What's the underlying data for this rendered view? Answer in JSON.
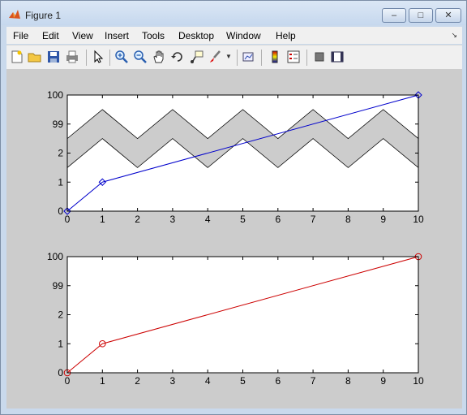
{
  "window": {
    "title": "Figure 1",
    "menu": [
      "File",
      "Edit",
      "View",
      "Insert",
      "Tools",
      "Desktop",
      "Window",
      "Help"
    ],
    "toolbar_icons": [
      "new-figure-icon",
      "open-file-icon",
      "save-icon",
      "print-icon",
      "pointer-icon",
      "zoom-in-icon",
      "zoom-out-icon",
      "pan-icon",
      "rotate-3d-icon",
      "data-cursor-icon",
      "brush-icon",
      "brush-dropdown-icon",
      "link-plot-icon",
      "colorbar-icon",
      "legend-icon",
      "hide-plot-tools-icon",
      "show-plot-tools-icon"
    ]
  },
  "chart_data": [
    {
      "type": "line",
      "x": [
        0,
        1,
        10
      ],
      "series": [
        {
          "values": [
            0,
            1,
            4
          ],
          "color": "#0000cc",
          "marker": "diamond"
        }
      ],
      "band": {
        "color": "#cccccc",
        "x": [
          0,
          1,
          2,
          3,
          4,
          5,
          6,
          7,
          8,
          9,
          10
        ],
        "upper": [
          2.5,
          3.5,
          2.5,
          3.5,
          2.5,
          3.5,
          2.5,
          3.5,
          2.5,
          3.5,
          2.5
        ],
        "lower": [
          1.5,
          2.5,
          1.5,
          2.5,
          1.5,
          2.5,
          1.5,
          2.5,
          1.5,
          2.5,
          1.5
        ]
      },
      "xticks": [
        "0",
        "1",
        "2",
        "3",
        "4",
        "5",
        "6",
        "7",
        "8",
        "9",
        "10"
      ],
      "yticks": [
        "0",
        "1",
        "2",
        "99",
        "100"
      ],
      "xlim": [
        0,
        10
      ],
      "ylim": [
        0,
        4
      ],
      "grid": false
    },
    {
      "type": "line",
      "x": [
        0,
        1,
        10
      ],
      "series": [
        {
          "values": [
            0,
            1,
            4
          ],
          "color": "#cc0000",
          "marker": "circle"
        }
      ],
      "xticks": [
        "0",
        "1",
        "2",
        "3",
        "4",
        "5",
        "6",
        "7",
        "8",
        "9",
        "10"
      ],
      "yticks": [
        "0",
        "1",
        "2",
        "99",
        "100"
      ],
      "xlim": [
        0,
        10
      ],
      "ylim": [
        0,
        4
      ],
      "grid": false
    }
  ]
}
